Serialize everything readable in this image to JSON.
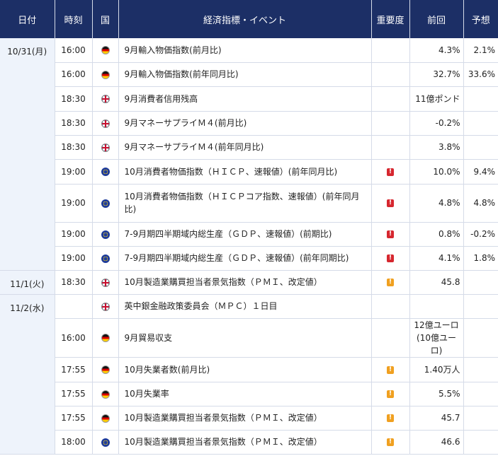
{
  "header": {
    "date": "日付",
    "time": "時刻",
    "country": "国",
    "event": "経済指標・イベント",
    "importance": "重要度",
    "previous": "前回",
    "forecast": "予想"
  },
  "colors": {
    "header_bg": "#1c2f66",
    "date_bg": "#eef3fb",
    "border": "#d5dbe8",
    "high": "#d6272f",
    "medium": "#f0a020"
  },
  "groups": [
    {
      "date": "10/31(月)",
      "rows": [
        {
          "time": "16:00",
          "country": "de",
          "event": "9月輸入物価指数(前月比)",
          "importance": "",
          "previous": "4.3%",
          "forecast": "2.1%"
        },
        {
          "time": "16:00",
          "country": "de",
          "event": "9月輸入物価指数(前年同月比)",
          "importance": "",
          "previous": "32.7%",
          "forecast": "33.6%"
        },
        {
          "time": "18:30",
          "country": "uk",
          "event": "9月消費者信用残高",
          "importance": "",
          "previous": "11億ポンド",
          "forecast": ""
        },
        {
          "time": "18:30",
          "country": "uk",
          "event": "9月マネーサプライＭ４(前月比)",
          "importance": "",
          "previous": "-0.2%",
          "forecast": ""
        },
        {
          "time": "18:30",
          "country": "uk",
          "event": "9月マネーサプライＭ４(前年同月比)",
          "importance": "",
          "previous": "3.8%",
          "forecast": ""
        },
        {
          "time": "19:00",
          "country": "eu",
          "event": "10月消費者物価指数（ＨＩＣＰ、速報値）(前年同月比)",
          "importance": "high",
          "previous": "10.0%",
          "forecast": "9.4%"
        },
        {
          "time": "19:00",
          "country": "eu",
          "event": "10月消費者物価指数（ＨＩＣＰコア指数、速報値）(前年同月比)",
          "importance": "high",
          "previous": "4.8%",
          "forecast": "4.8%"
        },
        {
          "time": "19:00",
          "country": "eu",
          "event": "7-9月期四半期域内総生産（ＧＤＰ、速報値）(前期比)",
          "importance": "high",
          "previous": "0.8%",
          "forecast": "-0.2%"
        },
        {
          "time": "19:00",
          "country": "eu",
          "event": "7-9月期四半期域内総生産（ＧＤＰ、速報値）(前年同期比)",
          "importance": "high",
          "previous": "4.1%",
          "forecast": "1.8%"
        }
      ]
    },
    {
      "date": "11/1(火)",
      "rows": [
        {
          "time": "18:30",
          "country": "uk",
          "event": "10月製造業購買担当者景気指数（ＰＭＩ、改定値）",
          "importance": "medium",
          "previous": "45.8",
          "forecast": ""
        }
      ]
    },
    {
      "date": "11/2(水)",
      "rows": [
        {
          "time": "",
          "country": "uk",
          "event": "英中銀金融政策委員会（ＭＰＣ）１日目",
          "importance": "",
          "previous": "",
          "forecast": ""
        },
        {
          "time": "16:00",
          "country": "de",
          "event": "9月貿易収支",
          "importance": "",
          "previous": "12億ユーロ(10億ユーロ)",
          "forecast": ""
        },
        {
          "time": "17:55",
          "country": "de",
          "event": "10月失業者数(前月比)",
          "importance": "medium",
          "previous": "1.40万人",
          "forecast": ""
        },
        {
          "time": "17:55",
          "country": "de",
          "event": "10月失業率",
          "importance": "medium",
          "previous": "5.5%",
          "forecast": ""
        },
        {
          "time": "17:55",
          "country": "de",
          "event": "10月製造業購買担当者景気指数（ＰＭＩ、改定値）",
          "importance": "medium",
          "previous": "45.7",
          "forecast": ""
        },
        {
          "time": "18:00",
          "country": "eu",
          "event": "10月製造業購買担当者景気指数（ＰＭＩ、改定値）",
          "importance": "medium",
          "previous": "46.6",
          "forecast": ""
        }
      ]
    }
  ],
  "row_heights": [
    [
      34,
      34,
      35,
      34,
      34,
      35,
      54,
      34,
      34
    ],
    [
      34
    ],
    [
      34,
      55,
      35,
      34,
      34,
      34
    ]
  ]
}
